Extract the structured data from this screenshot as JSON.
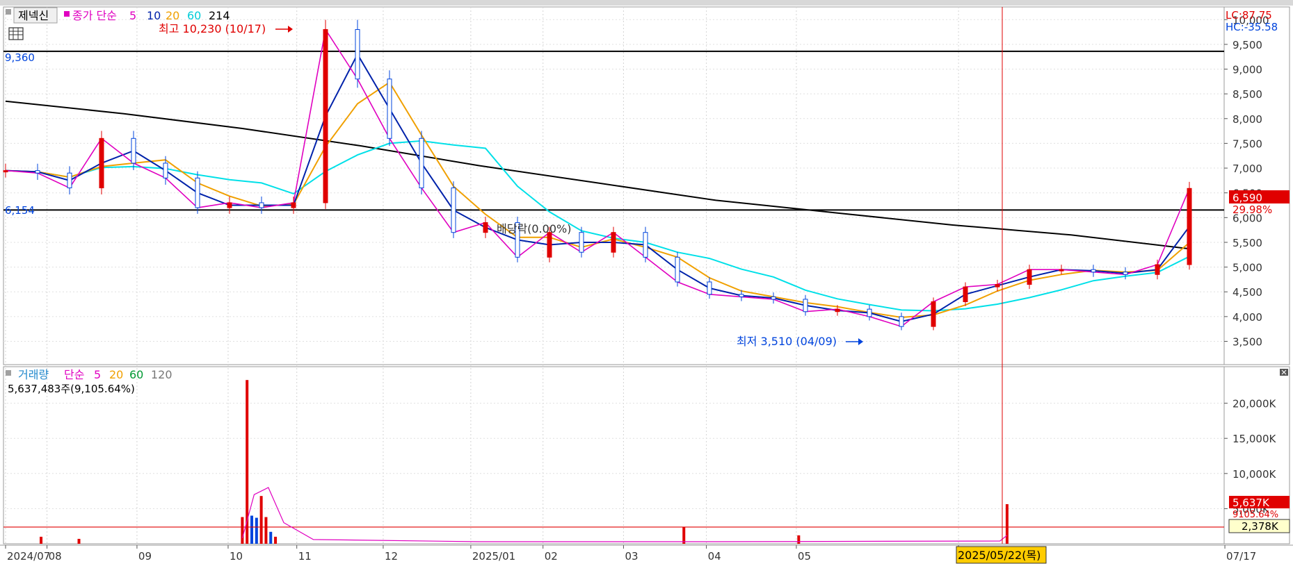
{
  "header": {
    "tab_label": "제넥신",
    "ma_title": "종가 단순",
    "ma_periods": [
      "5",
      "10",
      "20",
      "60",
      "214"
    ],
    "lc_label": "LC:87.75",
    "hc_label": "HC:-35.58"
  },
  "annotations": {
    "high_label": "최고 10,230 (10/17)",
    "low_label": "최저 3,510 (04/09)",
    "dividend_label": "배당락(0.00%)",
    "line_9360": "9,360",
    "line_6154": "6,154"
  },
  "price_badge": {
    "value": "6,590",
    "change": "29.98%"
  },
  "volume_header": {
    "title": "거래량",
    "ma_title": "단순",
    "ma_periods": [
      "5",
      "20",
      "60",
      "120"
    ],
    "volume_text": "5,637,483주(9,105.64%)"
  },
  "volume_badge": {
    "value": "5,637K",
    "pct": "9105.64%",
    "ma_value": "2,378K"
  },
  "x_axis": {
    "labels": [
      "2024/07",
      "08",
      "09",
      "10",
      "11",
      "12",
      "2025/01",
      "02",
      "03",
      "04",
      "05",
      "07",
      "07/17"
    ],
    "crosshair_label": "2025/05/22(목)"
  },
  "colors": {
    "ma5": "#e000c0",
    "ma10": "#0022aa",
    "ma20": "#f0a000",
    "ma60": "#00e0e8",
    "ma214": "#000000",
    "up": "#e00000",
    "down": "#0044dd",
    "crosshair": "#e00000"
  },
  "chart_data": [
    {
      "type": "candlestick",
      "title": "제넥신",
      "ylim": [
        3100,
        10200
      ],
      "y_ticks": [
        "3,500",
        "4,000",
        "4,500",
        "5,000",
        "5,500",
        "6,000",
        "6,500",
        "7,000",
        "7,500",
        "8,000",
        "8,500",
        "9,000",
        "9,500",
        "10,000"
      ],
      "horizontal_lines": [
        9360,
        6154
      ],
      "high": {
        "value": 10230,
        "date": "10/17"
      },
      "low": {
        "value": 3510,
        "date": "04/09"
      },
      "last_close": 6590,
      "change_pct": 29.98,
      "close_series": [
        {
          "date": "2024/07",
          "close": 6950
        },
        {
          "date": "2024/07 mid",
          "close": 6900
        },
        {
          "date": "2024/08",
          "close": 6600
        },
        {
          "date": "2024/08 mid",
          "close": 7600
        },
        {
          "date": "2024/08 late",
          "close": 7100
        },
        {
          "date": "2024/09",
          "close": 6800
        },
        {
          "date": "2024/09 mid",
          "close": 6200
        },
        {
          "date": "2024/09 late",
          "close": 6300
        },
        {
          "date": "2024/10",
          "close": 6200
        },
        {
          "date": "2024/10 mid",
          "close": 6300
        },
        {
          "date": "2024/10/17",
          "close": 9800
        },
        {
          "date": "2024/10 late",
          "close": 8800
        },
        {
          "date": "2024/11",
          "close": 7600
        },
        {
          "date": "2024/11 mid",
          "close": 6600
        },
        {
          "date": "2024/11 late",
          "close": 5700
        },
        {
          "date": "2024/12",
          "close": 5900
        },
        {
          "date": "2024/12 mid",
          "close": 5200
        },
        {
          "date": "2024/12 late",
          "close": 5700
        },
        {
          "date": "2025/01",
          "close": 5300
        },
        {
          "date": "2025/01 mid",
          "close": 5700
        },
        {
          "date": "2025/01 late",
          "close": 5200
        },
        {
          "date": "2025/02",
          "close": 4700
        },
        {
          "date": "2025/02 mid",
          "close": 4450
        },
        {
          "date": "2025/02 late",
          "close": 4400
        },
        {
          "date": "2025/03",
          "close": 4350
        },
        {
          "date": "2025/03 mid",
          "close": 4100
        },
        {
          "date": "2025/03 late",
          "close": 4150
        },
        {
          "date": "2025/04",
          "close": 4000
        },
        {
          "date": "2025/04/09",
          "close": 3800
        },
        {
          "date": "2025/04 late",
          "close": 4300
        },
        {
          "date": "2025/05",
          "close": 4600
        },
        {
          "date": "2025/05/22",
          "close": 4650
        },
        {
          "date": "2025/06",
          "close": 4950
        },
        {
          "date": "2025/06 mid",
          "close": 4950
        },
        {
          "date": "2025/06 late",
          "close": 4900
        },
        {
          "date": "2025/07",
          "close": 4850
        },
        {
          "date": "2025/07 mid",
          "close": 5050
        },
        {
          "date": "2025/07/17",
          "close": 6590
        }
      ],
      "ma214_series": [
        8350,
        8100,
        7800,
        7450,
        7050,
        6700,
        6350,
        6100,
        5850,
        5650,
        5370
      ]
    },
    {
      "type": "bar",
      "title": "거래량",
      "ylim": [
        0,
        25000
      ],
      "y_unit": "K",
      "y_ticks": [
        "5,000K",
        "10,000K",
        "15,000K",
        "20,000K"
      ],
      "reference_line": 2378,
      "last_volume": 5637483,
      "last_volume_pct": 9105.64,
      "bars": [
        {
          "date": "2024/07 mid",
          "value": 1000
        },
        {
          "date": "2024/08 mid",
          "value": 700
        },
        {
          "date": "2024/10/16",
          "value": 3800
        },
        {
          "date": "2024/10/17",
          "value": 23300
        },
        {
          "date": "2024/10/18",
          "value": 4000
        },
        {
          "date": "2024/10/21",
          "value": 3700
        },
        {
          "date": "2024/10/22",
          "value": 6800
        },
        {
          "date": "2024/10/23",
          "value": 3800
        },
        {
          "date": "2024/10/24",
          "value": 1700
        },
        {
          "date": "2024/10/25",
          "value": 1000
        },
        {
          "date": "2025/03 late",
          "value": 2400
        },
        {
          "date": "2025/05 early",
          "value": 1200
        },
        {
          "date": "2025/07/17",
          "value": 5637
        }
      ]
    }
  ]
}
